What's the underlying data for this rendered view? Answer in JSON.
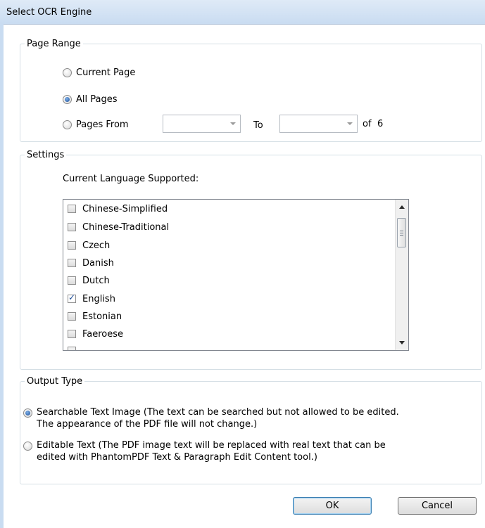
{
  "window": {
    "title": "Select OCR Engine"
  },
  "page_range": {
    "legend": "Page Range",
    "options": [
      {
        "label": "Current Page",
        "selected": false
      },
      {
        "label": "All Pages",
        "selected": true
      },
      {
        "label": "Pages From",
        "selected": false
      }
    ],
    "from_value": "",
    "to_label": "To",
    "to_value": "",
    "of_label": "of",
    "total_pages": "6"
  },
  "settings": {
    "legend": "Settings",
    "language_label": "Current Language Supported:",
    "languages": [
      {
        "label": "Chinese-Simplified",
        "checked": false
      },
      {
        "label": "Chinese-Traditional",
        "checked": false
      },
      {
        "label": "Czech",
        "checked": false
      },
      {
        "label": "Danish",
        "checked": false
      },
      {
        "label": "Dutch",
        "checked": false
      },
      {
        "label": "English",
        "checked": true
      },
      {
        "label": "Estonian",
        "checked": false
      },
      {
        "label": "Faeroese",
        "checked": false
      }
    ]
  },
  "output_type": {
    "legend": "Output Type",
    "options": [
      {
        "line1": "Searchable Text Image (The text can be searched but not allowed to be edited.",
        "line2": "The appearance of the PDF file will not change.)",
        "selected": true
      },
      {
        "line1": "Editable Text (The PDF image text will be replaced with real text that can be",
        "line2": "edited with PhantomPDF Text & Paragraph Edit Content tool.)",
        "selected": false
      }
    ]
  },
  "buttons": {
    "ok": "OK",
    "cancel": "Cancel"
  }
}
